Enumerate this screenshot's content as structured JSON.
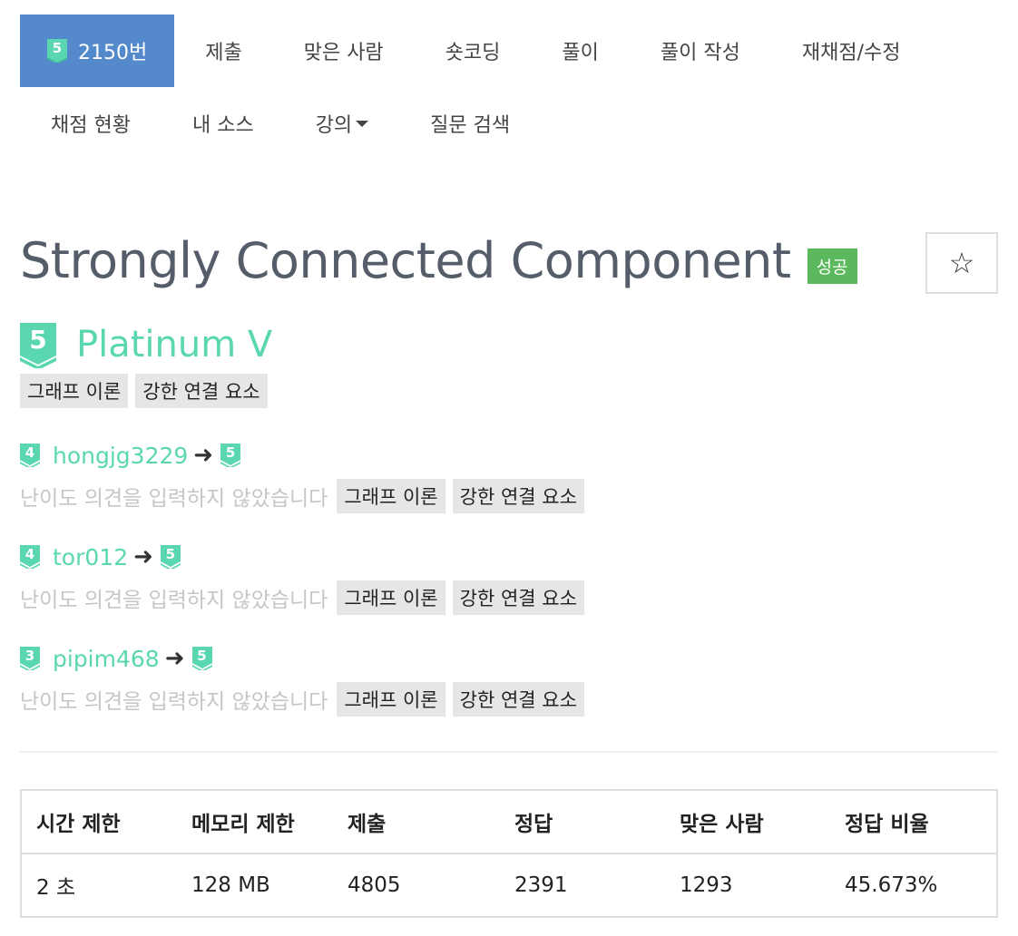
{
  "nav": {
    "problem_number": "2150번",
    "problem_tier_num": "5",
    "row1": [
      "제출",
      "맞은 사람",
      "숏코딩",
      "풀이",
      "풀이 작성",
      "재채점/수정"
    ],
    "row2": [
      "채점 현황",
      "내 소스",
      "강의",
      "질문 검색"
    ]
  },
  "problem": {
    "title": "Strongly Connected Component",
    "status": "성공",
    "star": "☆",
    "tier_num": "5",
    "tier_name": "Platinum V",
    "tags": [
      "그래프 이론",
      "강한 연결 요소"
    ]
  },
  "opinions": [
    {
      "from_num": "4",
      "user": "hongjg3229",
      "to_num": "5",
      "comment": "난이도 의견을 입력하지 않았습니다",
      "tags": [
        "그래프 이론",
        "강한 연결 요소"
      ]
    },
    {
      "from_num": "4",
      "user": "tor012",
      "to_num": "5",
      "comment": "난이도 의견을 입력하지 않았습니다",
      "tags": [
        "그래프 이론",
        "강한 연결 요소"
      ]
    },
    {
      "from_num": "3",
      "user": "pipim468",
      "to_num": "5",
      "comment": "난이도 의견을 입력하지 않았습니다",
      "tags": [
        "그래프 이론",
        "강한 연결 요소"
      ]
    }
  ],
  "arrow": "➜",
  "stats": {
    "headers": [
      "시간 제한",
      "메모리 제한",
      "제출",
      "정답",
      "맞은 사람",
      "정답 비율"
    ],
    "values": [
      "2 초",
      "128 MB",
      "4805",
      "2391",
      "1293",
      "45.673%"
    ]
  },
  "colors": {
    "nav_active": "#5489cc",
    "tier_green": "#5ad7b1",
    "success": "#5cb85c"
  }
}
